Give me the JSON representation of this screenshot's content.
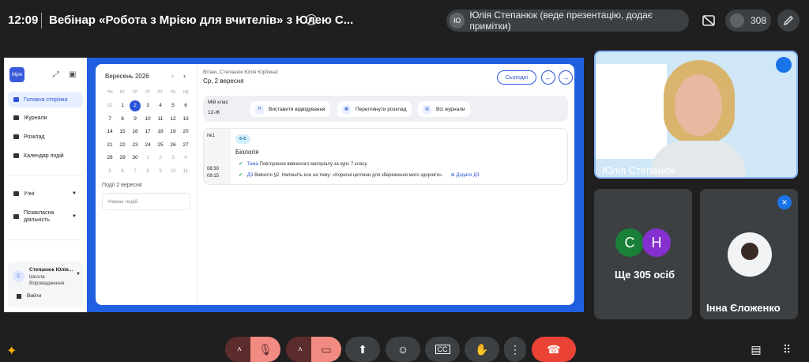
{
  "meeting": {
    "time": "12:09",
    "title": "Вебінар «Робота з Мрією для вчителів» з Юлею С...",
    "presenter_initial": "Ю",
    "presenter_label": "Юлія Степанюк (веде презентацію, додає примітки)",
    "participant_count": "308"
  },
  "shared_app": {
    "logo": "Мрія",
    "nav": [
      "Головна сторінка",
      "Журнали",
      "Розклад",
      "Календар подій"
    ],
    "nav2": [
      "Учні",
      "Позакласна діяльність"
    ],
    "user_initial": "С",
    "user_name": "Степанюк Юлія...",
    "user_school": "Школа Впровадження",
    "logout": "Вийти",
    "calendar": {
      "month": "Вересень 2026",
      "weekdays": [
        "ПН",
        "ВТ",
        "СР",
        "ЧТ",
        "ПТ",
        "СБ",
        "НД"
      ],
      "weeks": [
        [
          "31",
          "1",
          "2",
          "3",
          "4",
          "5",
          "6"
        ],
        [
          "7",
          "8",
          "9",
          "10",
          "11",
          "12",
          "13"
        ],
        [
          "14",
          "15",
          "16",
          "17",
          "18",
          "19",
          "20"
        ],
        [
          "21",
          "22",
          "23",
          "24",
          "25",
          "26",
          "27"
        ],
        [
          "28",
          "29",
          "30",
          "1",
          "2",
          "3",
          "4"
        ],
        [
          "5",
          "6",
          "7",
          "8",
          "9",
          "10",
          "11"
        ]
      ],
      "events_title": "Події 2 вересня",
      "no_events": "Немає подій"
    },
    "greeting": "Вітаю, Степанюк Юлія Юріївна!",
    "date": "Ср, 2 вересня",
    "today_btn": "Сьогодні",
    "class_label": "Мій клас",
    "class_value": "12-Ж",
    "actions": [
      "Виставити відвідування",
      "Переглянути розклад",
      "Всі журнали"
    ],
    "lesson": {
      "number": "№1",
      "time_start": "08:30",
      "time_end": "09:15",
      "class_tag": "6-Є",
      "subject": "Біологія",
      "topic_label": "Тема",
      "topic": "Повторення вивченого матеріалу за курс 7 класу.",
      "hw_label": "ДЗ",
      "hw": "Вивчити §2. Напишіть есе на тему: «Корисні цеглини для збереження мого здоров'я».",
      "add_hw": "Додати ДЗ"
    }
  },
  "participants": {
    "presenter_tile_name": "Юлія Степанюк",
    "others_initials": [
      "С",
      "Н"
    ],
    "others_label": "Ще 305 осіб",
    "tile3_name": "Інна Єложенко"
  }
}
